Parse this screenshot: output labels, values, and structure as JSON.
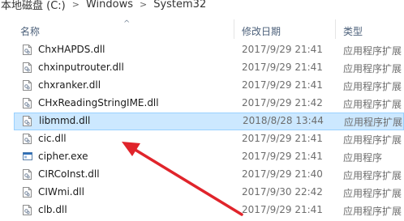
{
  "breadcrumb": {
    "items": [
      "本地磁盘 (C:)",
      "Windows",
      "System32"
    ],
    "separator": ">"
  },
  "columns": {
    "name": "名称",
    "date": "修改日期",
    "type": "类型"
  },
  "files": [
    {
      "name": "ChxHAPDS.dll",
      "date": "2017/9/29 21:41",
      "type": "应用程序扩展",
      "icon": "dll-file-icon"
    },
    {
      "name": "chxinputrouter.dll",
      "date": "2017/9/29 21:41",
      "type": "应用程序扩展",
      "icon": "dll-file-icon"
    },
    {
      "name": "chxranker.dll",
      "date": "2017/9/29 21:41",
      "type": "应用程序扩展",
      "icon": "dll-file-icon"
    },
    {
      "name": "CHxReadingStringIME.dll",
      "date": "2017/9/29 21:42",
      "type": "应用程序扩展",
      "icon": "dll-file-icon"
    },
    {
      "name": "libmmd.dll",
      "date": "2018/8/28 13:44",
      "type": "应用程序扩展",
      "icon": "dll-file-icon",
      "selected": true
    },
    {
      "name": "cic.dll",
      "date": "2017/9/29 21:41",
      "type": "应用程序扩展",
      "icon": "dll-file-icon"
    },
    {
      "name": "cipher.exe",
      "date": "2017/9/29 21:41",
      "type": "应用程序",
      "icon": "exe-file-icon"
    },
    {
      "name": "CIRCoInst.dll",
      "date": "2017/9/29 21:40",
      "type": "应用程序扩展",
      "icon": "dll-file-icon"
    },
    {
      "name": "CIWmi.dll",
      "date": "2017/9/30 22:42",
      "type": "应用程序扩展",
      "icon": "dll-file-icon"
    },
    {
      "name": "clb.dll",
      "date": "2017/9/29 21:41",
      "type": "应用程序扩展",
      "icon": "dll-file-icon"
    }
  ],
  "colors": {
    "selection_background": "#cce8ff",
    "selection_border": "#99d1ff",
    "annotation_arrow": "#e0242b"
  }
}
